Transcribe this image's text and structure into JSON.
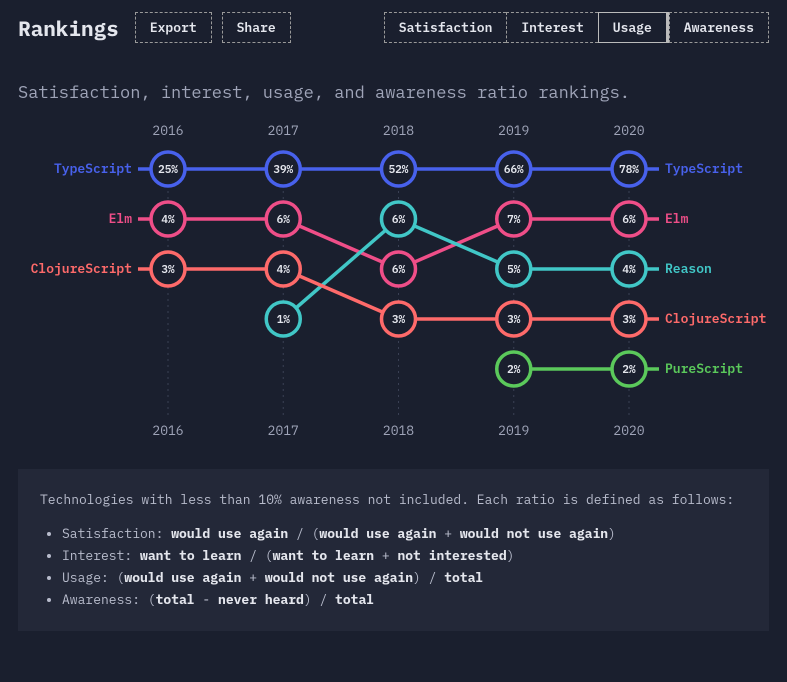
{
  "header": {
    "title": "Rankings",
    "export_label": "Export",
    "share_label": "Share",
    "tabs": [
      "Satisfaction",
      "Interest",
      "Usage",
      "Awareness"
    ],
    "active_tab": "Usage"
  },
  "subtitle": "Satisfaction, interest, usage, and awareness ratio rankings.",
  "chart_data": {
    "type": "bump-chart",
    "years": [
      "2016",
      "2017",
      "2018",
      "2019",
      "2020"
    ],
    "rank_rows": 5,
    "series": [
      {
        "name": "TypeScript",
        "color": "#4861ec",
        "points": [
          {
            "year": "2016",
            "rank": 1,
            "value": "25%"
          },
          {
            "year": "2017",
            "rank": 1,
            "value": "39%"
          },
          {
            "year": "2018",
            "rank": 1,
            "value": "52%"
          },
          {
            "year": "2019",
            "rank": 1,
            "value": "66%"
          },
          {
            "year": "2020",
            "rank": 1,
            "value": "78%"
          }
        ]
      },
      {
        "name": "Elm",
        "color": "#ef4e88",
        "points": [
          {
            "year": "2016",
            "rank": 2,
            "value": "4%"
          },
          {
            "year": "2017",
            "rank": 2,
            "value": "6%"
          },
          {
            "year": "2018",
            "rank": 3,
            "value": "6%"
          },
          {
            "year": "2019",
            "rank": 2,
            "value": "7%"
          },
          {
            "year": "2020",
            "rank": 2,
            "value": "6%"
          }
        ]
      },
      {
        "name": "Reason",
        "color": "#41c7c7",
        "points": [
          {
            "year": "2017",
            "rank": 4,
            "value": "1%"
          },
          {
            "year": "2018",
            "rank": 2,
            "value": "6%"
          },
          {
            "year": "2019",
            "rank": 3,
            "value": "5%"
          },
          {
            "year": "2020",
            "rank": 3,
            "value": "4%"
          }
        ]
      },
      {
        "name": "ClojureScript",
        "color": "#fe6a6a",
        "points": [
          {
            "year": "2016",
            "rank": 3,
            "value": "3%"
          },
          {
            "year": "2017",
            "rank": 3,
            "value": "4%"
          },
          {
            "year": "2018",
            "rank": 4,
            "value": "3%"
          },
          {
            "year": "2019",
            "rank": 4,
            "value": "3%"
          },
          {
            "year": "2020",
            "rank": 4,
            "value": "3%"
          }
        ]
      },
      {
        "name": "PureScript",
        "color": "#5bc95b",
        "points": [
          {
            "year": "2019",
            "rank": 5,
            "value": "2%"
          },
          {
            "year": "2020",
            "rank": 5,
            "value": "2%"
          }
        ]
      }
    ],
    "left_labels": [
      {
        "rank": 1,
        "name": "TypeScript",
        "color": "#4861ec"
      },
      {
        "rank": 2,
        "name": "Elm",
        "color": "#ef4e88"
      },
      {
        "rank": 3,
        "name": "ClojureScript",
        "color": "#fe6a6a"
      }
    ],
    "right_labels": [
      {
        "rank": 1,
        "name": "TypeScript",
        "color": "#4861ec"
      },
      {
        "rank": 2,
        "name": "Elm",
        "color": "#ef4e88"
      },
      {
        "rank": 3,
        "name": "Reason",
        "color": "#41c7c7"
      },
      {
        "rank": 4,
        "name": "ClojureScript",
        "color": "#fe6a6a"
      },
      {
        "rank": 5,
        "name": "PureScript",
        "color": "#5bc95b"
      }
    ]
  },
  "footer": {
    "intro": "Technologies with less than 10% awareness not included. Each ratio is defined as follows:",
    "defs": [
      {
        "term": "Satisfaction",
        "formula_parts": [
          "",
          "would use again",
          " / (",
          "would use again",
          " + ",
          "would not use again",
          ")"
        ]
      },
      {
        "term": "Interest",
        "formula_parts": [
          "",
          "want to learn",
          " / (",
          "want to learn",
          " + ",
          "not interested",
          ")"
        ]
      },
      {
        "term": "Usage",
        "formula_parts": [
          "(",
          "would use again",
          " + ",
          "would not use again",
          ") / ",
          "total",
          ""
        ]
      },
      {
        "term": "Awareness",
        "formula_parts": [
          "(",
          "total",
          " - ",
          "never heard",
          ") / ",
          "total",
          ""
        ]
      }
    ]
  }
}
